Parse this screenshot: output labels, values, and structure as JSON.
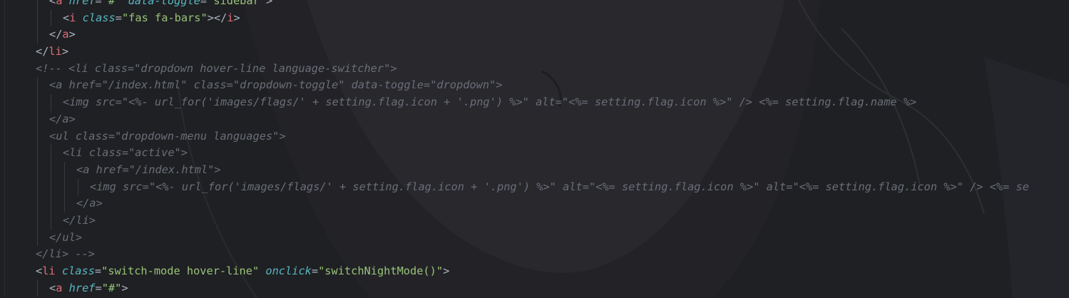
{
  "colors": {
    "background": "#1f2023",
    "tag": "#e06c75",
    "attribute": "#56b6c2",
    "string": "#98c379",
    "punctuation": "#abb2bf",
    "comment": "#6a6e78",
    "indent_guide": "#3a3b40"
  },
  "lines": [
    {
      "indent": 1,
      "tokens": [
        {
          "t": "<",
          "c": "punct"
        },
        {
          "t": "a",
          "c": "tag"
        },
        {
          "t": " ",
          "c": "punct"
        },
        {
          "t": "href",
          "c": "attr"
        },
        {
          "t": "=",
          "c": "eq"
        },
        {
          "t": "\"#\"",
          "c": "str"
        },
        {
          "t": " ",
          "c": "punct"
        },
        {
          "t": "data-toggle",
          "c": "attr"
        },
        {
          "t": "=",
          "c": "eq"
        },
        {
          "t": "\"sidebar\"",
          "c": "str"
        },
        {
          "t": ">",
          "c": "punct"
        }
      ]
    },
    {
      "indent": 2,
      "tokens": [
        {
          "t": "<",
          "c": "punct"
        },
        {
          "t": "i",
          "c": "tag"
        },
        {
          "t": " ",
          "c": "punct"
        },
        {
          "t": "class",
          "c": "attr"
        },
        {
          "t": "=",
          "c": "eq"
        },
        {
          "t": "\"fas fa-bars\"",
          "c": "str"
        },
        {
          "t": "></",
          "c": "punct"
        },
        {
          "t": "i",
          "c": "tag"
        },
        {
          "t": ">",
          "c": "punct"
        }
      ]
    },
    {
      "indent": 1,
      "tokens": [
        {
          "t": "</",
          "c": "punct"
        },
        {
          "t": "a",
          "c": "tag"
        },
        {
          "t": ">",
          "c": "punct"
        }
      ]
    },
    {
      "indent": 0,
      "tokens": [
        {
          "t": "</",
          "c": "punct"
        },
        {
          "t": "li",
          "c": "tag"
        },
        {
          "t": ">",
          "c": "punct"
        }
      ]
    },
    {
      "indent": 0,
      "tokens": [
        {
          "t": "<!-- <li class=\"dropdown hover-line language-switcher\">",
          "c": "cmt"
        }
      ]
    },
    {
      "indent": 1,
      "tokens": [
        {
          "t": "<a href=\"/index.html\" class=\"dropdown-toggle\" data-toggle=\"dropdown\">",
          "c": "cmt"
        }
      ]
    },
    {
      "indent": 2,
      "tokens": [
        {
          "t": "<img src=\"<%- url_for('images/flags/' + setting.flag.icon + '.png') %>\" alt=\"<%= setting.flag.icon %>\" /> <%= setting.flag.name %>",
          "c": "cmt"
        }
      ]
    },
    {
      "indent": 1,
      "tokens": [
        {
          "t": "</a>",
          "c": "cmt"
        }
      ]
    },
    {
      "indent": 1,
      "tokens": [
        {
          "t": "<ul class=\"dropdown-menu languages\">",
          "c": "cmt"
        }
      ]
    },
    {
      "indent": 2,
      "tokens": [
        {
          "t": "<li class=\"active\">",
          "c": "cmt"
        }
      ]
    },
    {
      "indent": 3,
      "tokens": [
        {
          "t": "<a href=\"/index.html\">",
          "c": "cmt"
        }
      ]
    },
    {
      "indent": 4,
      "tokens": [
        {
          "t": "<img src=\"<%- url_for('images/flags/' + setting.flag.icon + '.png') %>\" alt=\"<%= setting.flag.icon %>\" alt=\"<%= setting.flag.icon %>\" /> <%= se",
          "c": "cmt"
        }
      ]
    },
    {
      "indent": 3,
      "tokens": [
        {
          "t": "</a>",
          "c": "cmt"
        }
      ]
    },
    {
      "indent": 2,
      "tokens": [
        {
          "t": "</li>",
          "c": "cmt"
        }
      ]
    },
    {
      "indent": 1,
      "tokens": [
        {
          "t": "</ul>",
          "c": "cmt"
        }
      ]
    },
    {
      "indent": 0,
      "tokens": [
        {
          "t": "</li> -->",
          "c": "cmt"
        }
      ]
    },
    {
      "indent": 0,
      "tokens": [
        {
          "t": "<",
          "c": "punct"
        },
        {
          "t": "li",
          "c": "tag"
        },
        {
          "t": " ",
          "c": "punct"
        },
        {
          "t": "class",
          "c": "attr"
        },
        {
          "t": "=",
          "c": "eq"
        },
        {
          "t": "\"switch-mode hover-line\"",
          "c": "str"
        },
        {
          "t": " ",
          "c": "punct"
        },
        {
          "t": "onclick",
          "c": "attr"
        },
        {
          "t": "=",
          "c": "eq"
        },
        {
          "t": "\"switchNightMode()\"",
          "c": "str"
        },
        {
          "t": ">",
          "c": "punct"
        }
      ]
    },
    {
      "indent": 1,
      "tokens": [
        {
          "t": "<",
          "c": "punct"
        },
        {
          "t": "a",
          "c": "tag"
        },
        {
          "t": " ",
          "c": "punct"
        },
        {
          "t": "href",
          "c": "attr"
        },
        {
          "t": "=",
          "c": "eq"
        },
        {
          "t": "\"#\"",
          "c": "str"
        },
        {
          "t": ">",
          "c": "punct"
        }
      ]
    }
  ]
}
